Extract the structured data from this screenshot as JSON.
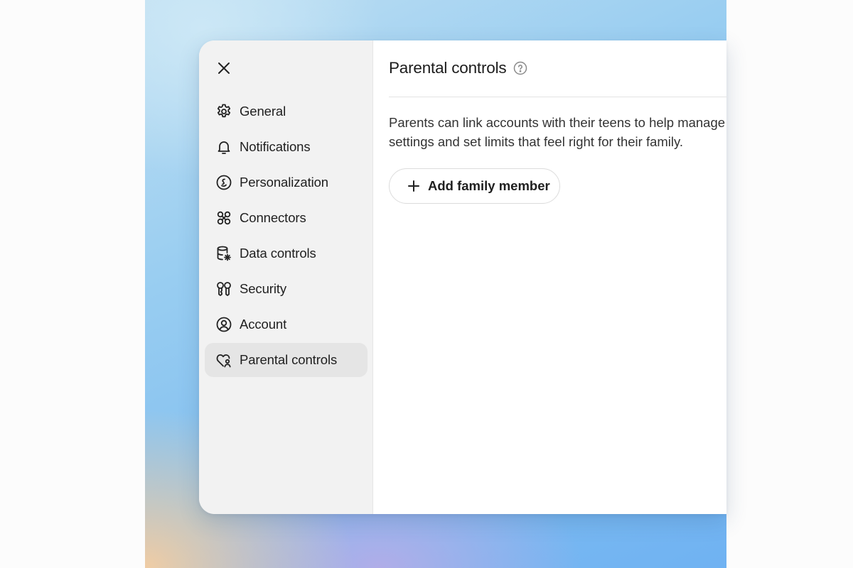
{
  "sidebar": {
    "close_icon": "close-icon",
    "items": [
      {
        "label": "General",
        "icon": "gear-icon"
      },
      {
        "label": "Notifications",
        "icon": "bell-icon"
      },
      {
        "label": "Personalization",
        "icon": "smiley-circle-icon"
      },
      {
        "label": "Connectors",
        "icon": "command-icon"
      },
      {
        "label": "Data controls",
        "icon": "database-gear-icon"
      },
      {
        "label": "Security",
        "icon": "key-icon"
      },
      {
        "label": "Account",
        "icon": "user-circle-icon"
      },
      {
        "label": "Parental controls",
        "icon": "heart-person-icon"
      }
    ],
    "active_item": "Parental controls"
  },
  "main": {
    "title": "Parental controls",
    "help_icon": "question-circle-icon",
    "description_line1": "Parents can link accounts with their teens to help manage c",
    "description_line2": "settings and set limits that feel right for their family.",
    "add_button_label": "Add family member",
    "add_button_icon": "plus-icon"
  },
  "colors": {
    "sidebar_bg": "#f2f2f2",
    "active_item_bg": "#e5e5e5",
    "text": "#1f1f1f",
    "desktop_accent": "#86c1f0"
  }
}
